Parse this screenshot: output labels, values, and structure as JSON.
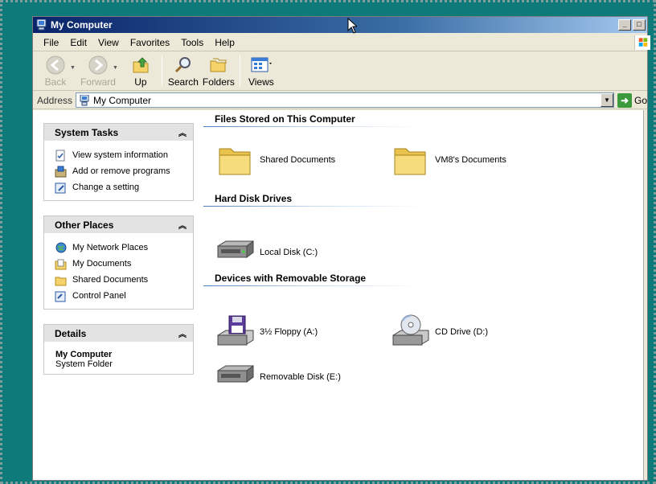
{
  "window": {
    "title": "My Computer",
    "buttons": {
      "minimize": "_",
      "maximize": "□"
    }
  },
  "menu": [
    "File",
    "Edit",
    "View",
    "Favorites",
    "Tools",
    "Help"
  ],
  "toolbar": {
    "back": "Back",
    "forward": "Forward",
    "up": "Up",
    "search": "Search",
    "folders": "Folders",
    "views": "Views"
  },
  "address": {
    "label": "Address",
    "value": "My Computer",
    "go": "Go"
  },
  "task_pane": {
    "system_tasks": {
      "title": "System Tasks",
      "items": [
        "View system information",
        "Add or remove programs",
        "Change a setting"
      ]
    },
    "other_places": {
      "title": "Other Places",
      "items": [
        "My Network Places",
        "My Documents",
        "Shared Documents",
        "Control Panel"
      ]
    },
    "details": {
      "title": "Details",
      "name": "My Computer",
      "type": "System Folder"
    }
  },
  "sections": {
    "files": {
      "title": "Files Stored on This Computer",
      "items": [
        "Shared Documents",
        "VM8's Documents"
      ]
    },
    "hard_disks": {
      "title": "Hard Disk Drives",
      "items": [
        "Local Disk (C:)"
      ]
    },
    "removable": {
      "title": "Devices with Removable Storage",
      "items": [
        "3½ Floppy (A:)",
        "CD Drive (D:)",
        "Removable Disk (E:)"
      ]
    }
  },
  "colors": {
    "desktop": "#0f7a7a",
    "titlebar_start": "#0a246a",
    "titlebar_end": "#a6caf0",
    "panel_header": "#e3e3e3"
  }
}
